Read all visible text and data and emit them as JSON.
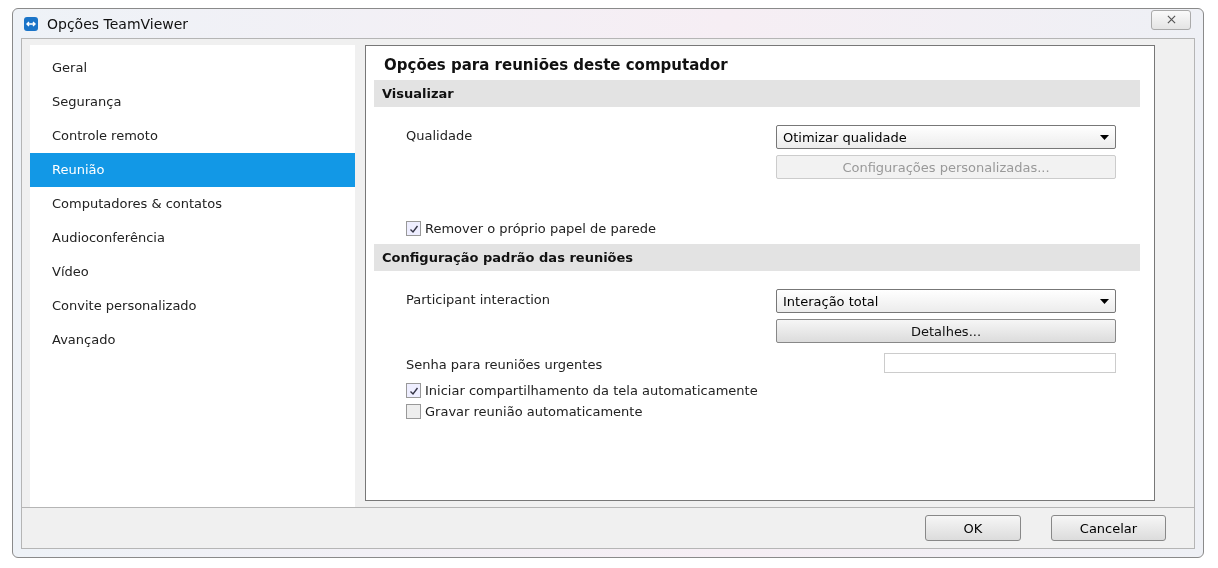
{
  "window": {
    "title": "Opções TeamViewer"
  },
  "sidebar": {
    "items": [
      {
        "label": "Geral",
        "selected": false
      },
      {
        "label": "Segurança",
        "selected": false
      },
      {
        "label": "Controle remoto",
        "selected": false
      },
      {
        "label": "Reunião",
        "selected": true
      },
      {
        "label": "Computadores & contatos",
        "selected": false
      },
      {
        "label": "Audioconferência",
        "selected": false
      },
      {
        "label": "Vídeo",
        "selected": false
      },
      {
        "label": "Convite personalizado",
        "selected": false
      },
      {
        "label": "Avançado",
        "selected": false
      }
    ]
  },
  "panel": {
    "title": "Opções para reuniões deste computador",
    "sections": [
      {
        "header": "Visualizar",
        "rows": [
          {
            "kind": "dropdown",
            "label": "Qualidade",
            "value": "Otimizar qualidade",
            "button": {
              "label": "Configurações personalizadas...",
              "disabled": true
            }
          },
          {
            "kind": "spacer"
          },
          {
            "kind": "checkbox",
            "label": "Remover o próprio papel de parede",
            "checked": true
          }
        ]
      },
      {
        "header": "Configuração padrão das reuniões",
        "rows": [
          {
            "kind": "dropdown",
            "label": "Participant interaction",
            "value": "Interação total",
            "button": {
              "label": "Detalhes...",
              "disabled": false
            }
          },
          {
            "kind": "password",
            "label": "Senha para reuniões urgentes"
          },
          {
            "kind": "checkbox",
            "label": "Iniciar compartilhamento da tela automaticamente",
            "checked": true
          },
          {
            "kind": "checkbox",
            "label": "Gravar reunião automaticamente",
            "checked": false
          }
        ]
      }
    ]
  },
  "buttons": [
    "OK",
    "Cancelar"
  ]
}
